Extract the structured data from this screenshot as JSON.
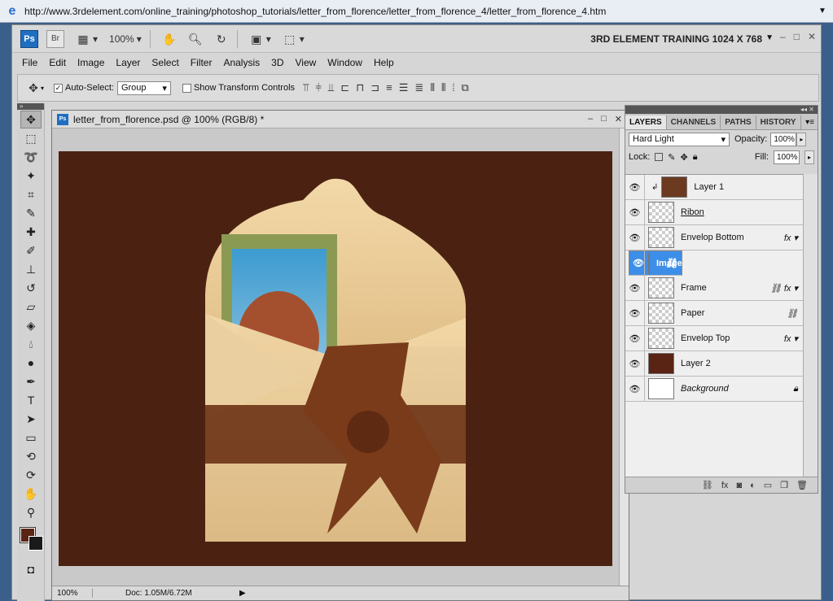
{
  "browser": {
    "url": "http://www.3rdelement.com/online_training/photoshop_tutorials/letter_from_florence/letter_from_florence_4/letter_from_florence_4.htm"
  },
  "appbar": {
    "ps": "Ps",
    "br": "Br",
    "zoom": "100%",
    "workspace": "3RD ELEMENT TRAINING 1024 X 768"
  },
  "menu": [
    "File",
    "Edit",
    "Image",
    "Layer",
    "Select",
    "Filter",
    "Analysis",
    "3D",
    "View",
    "Window",
    "Help"
  ],
  "options": {
    "auto_select_label": "Auto-Select:",
    "auto_select_value": "Group",
    "transform_label": "Show Transform Controls"
  },
  "document": {
    "title": "letter_from_florence.psd @ 100% (RGB/8) *",
    "zoom": "100%",
    "doc_size": "Doc: 1.05M/6.72M"
  },
  "canvas": {
    "bg_color": "#4b2212"
  },
  "colors": {
    "foreground": "#5a2414",
    "background": "#1a1a1a",
    "selection": "#3d8ee8"
  },
  "layers_panel": {
    "tabs": [
      "LAYERS",
      "CHANNELS",
      "PATHS",
      "HISTORY"
    ],
    "blend_mode": "Hard Light",
    "opacity_label": "Opacity:",
    "opacity": "100%",
    "lock_label": "Lock:",
    "fill_label": "Fill:",
    "fill": "100%",
    "layers": [
      {
        "name": "Layer 1"
      },
      {
        "name": "Ribon"
      },
      {
        "name": "Envelop Bottom"
      },
      {
        "name": "Image"
      },
      {
        "name": "Frame"
      },
      {
        "name": "Paper"
      },
      {
        "name": "Envelop Top"
      },
      {
        "name": "Layer 2"
      },
      {
        "name": "Background"
      }
    ]
  }
}
